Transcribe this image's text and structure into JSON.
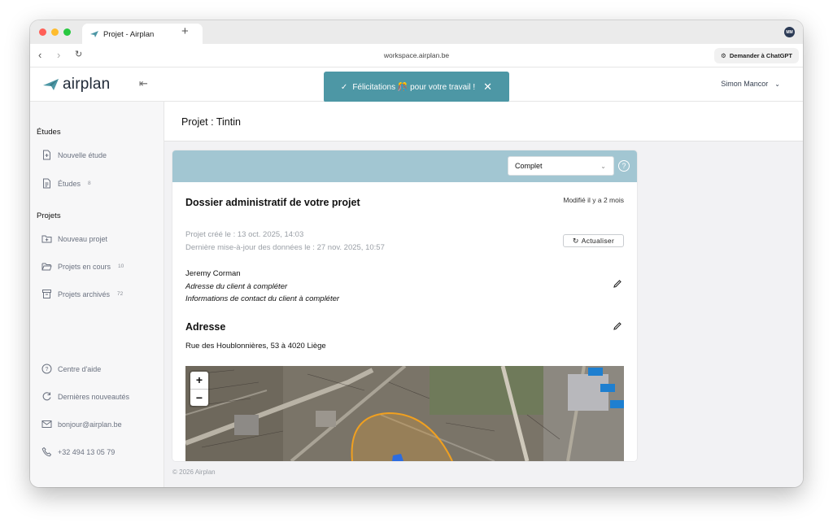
{
  "browser": {
    "tab_title": "Projet - Airplan",
    "new_tab": "+",
    "url": "workspace.airplan.be",
    "chatgpt_button": "Demander à ChatGPT",
    "profile_initials": "MM"
  },
  "header": {
    "logo_text": "airplan",
    "toast_message": "Félicitations 🎊 pour votre travail !",
    "user_name": "Simon Mancor"
  },
  "sidebar": {
    "studies_title": "Études",
    "new_study": "Nouvelle étude",
    "studies": "Études",
    "studies_count": "8",
    "projects_title": "Projets",
    "new_project": "Nouveau projet",
    "projects_in_progress": "Projets en cours",
    "projects_in_progress_count": "10",
    "archived_projects": "Projets archivés",
    "archived_projects_count": "72",
    "help_center": "Centre d'aide",
    "latest_news": "Dernières nouveautés",
    "email": "bonjour@airplan.be",
    "phone": "+32 494 13 05 79"
  },
  "page": {
    "title": "Projet : Tintin",
    "status_select": "Complet",
    "dossier_title": "Dossier administratif de votre projet",
    "modified": "Modifié il y a 2 mois",
    "created": "Projet créé le : 13 oct. 2025, 14:03",
    "updated": "Dernière mise-à-jour des données le : 27 nov. 2025, 10:57",
    "refresh_button": "Actualiser",
    "client_name": "Jeremy Corman",
    "client_address": "Adresse du client à compléter",
    "client_contact": "Informations de contact du client à compléter",
    "address_title": "Adresse",
    "address": "Rue des Houblonnières, 53 à 4020 Liège",
    "zoom_in": "+",
    "zoom_out": "−",
    "footer": "© 2026 Airplan"
  },
  "colors": {
    "accent": "#4d97a5",
    "card_header": "#a2c6d2",
    "parcel_outline": "#f0a020"
  }
}
